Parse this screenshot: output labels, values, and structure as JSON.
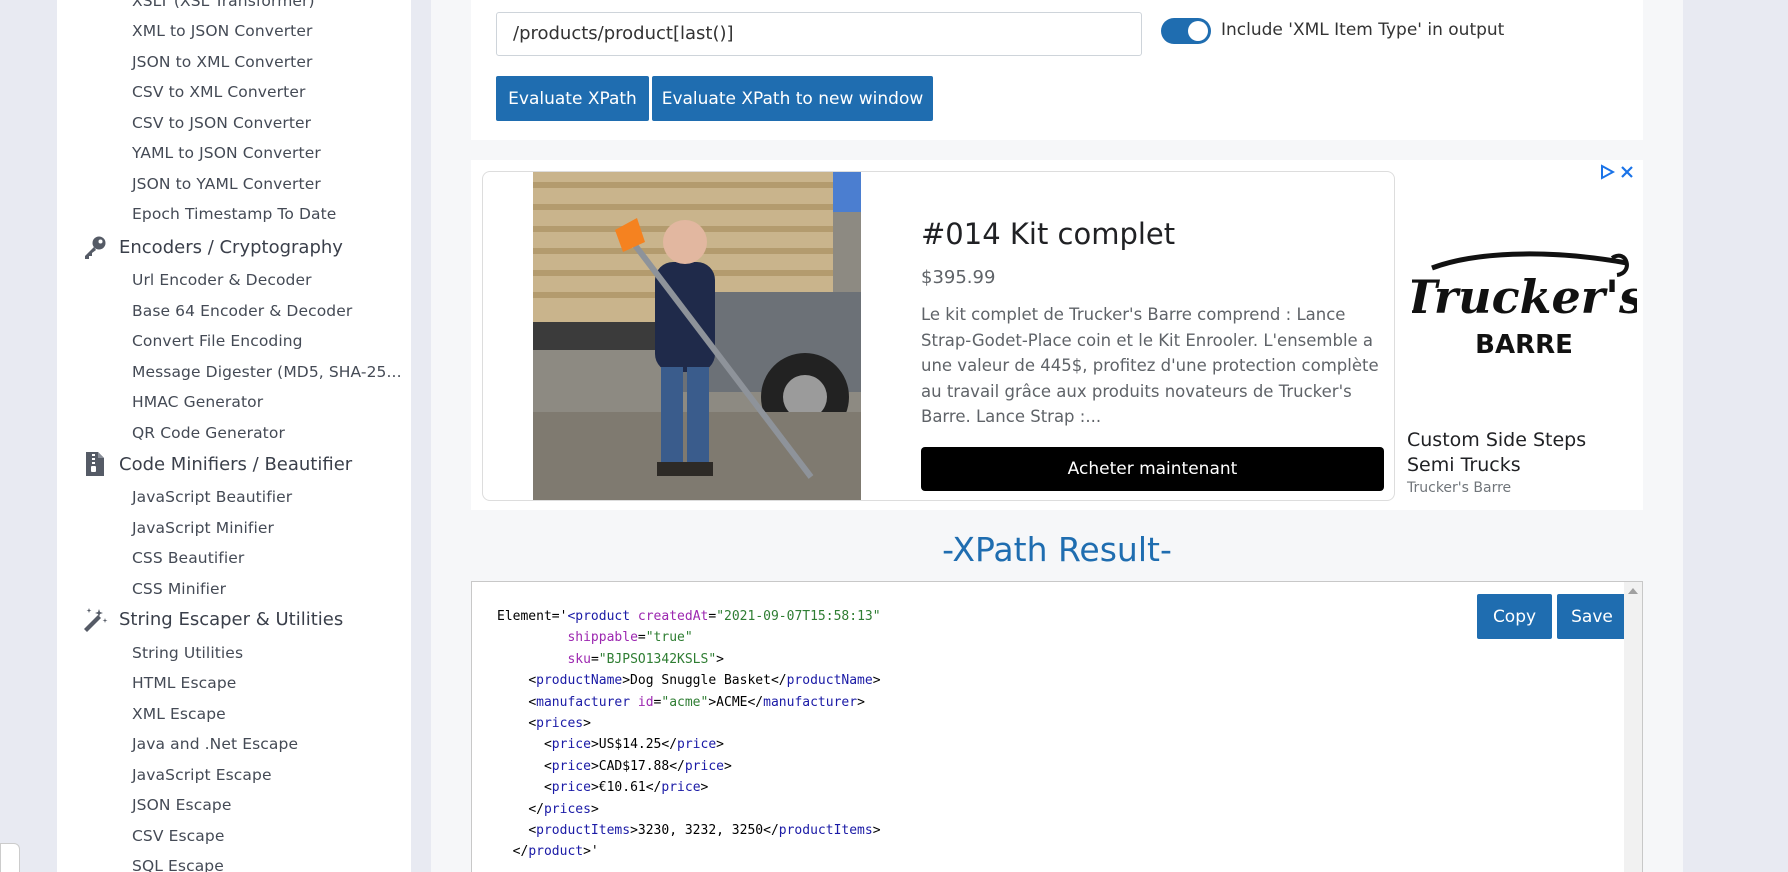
{
  "sidebar": {
    "partial_top_item": "XSLT (XSL Transformer)",
    "converters": [
      "XML to JSON Converter",
      "JSON to XML Converter",
      "CSV to XML Converter",
      "CSV to JSON Converter",
      "YAML to JSON Converter",
      "JSON to YAML Converter",
      "Epoch Timestamp To Date"
    ],
    "encoders_heading": "Encoders / Cryptography",
    "encoders": [
      "Url Encoder & Decoder",
      "Base 64 Encoder & Decoder",
      "Convert File Encoding",
      "Message Digester (MD5, SHA-25...",
      "HMAC Generator",
      "QR Code Generator"
    ],
    "minifiers_heading": "Code Minifiers / Beautifier",
    "minifiers": [
      "JavaScript Beautifier",
      "JavaScript Minifier",
      "CSS Beautifier",
      "CSS Minifier"
    ],
    "escaper_heading": "String Escaper & Utilities",
    "escapers": [
      "String Utilities",
      "HTML Escape",
      "XML Escape",
      "Java and .Net Escape",
      "JavaScript Escape",
      "JSON Escape",
      "CSV Escape",
      "SQL Escape"
    ]
  },
  "form": {
    "xpath_value": "/products/product[last()]",
    "toggle_on": true,
    "toggle_label": "Include 'XML Item Type' in output",
    "evaluate_label": "Evaluate XPath",
    "evaluate_new_window_label": "Evaluate XPath to new window"
  },
  "ad": {
    "title": "#014 Kit complet",
    "price": "$395.99",
    "description": "Le kit complet de Trucker's Barre comprend : Lance Strap-Godet-Place coin et le Kit Enrooler. L'ensemble a une valeur de 445$, profitez d'une protection complète au travail grâce aux produits novateurs de Trucker's Barre. Lance Strap :...",
    "cta_label": "Acheter maintenant",
    "logo_line1": "Trucker's",
    "logo_line2": "BARRE",
    "side_title": "Custom Side Steps Semi Trucks",
    "side_source": "Trucker's Barre"
  },
  "result": {
    "title": "-XPath Result-",
    "copy_label": "Copy",
    "save_label": "Save",
    "lines": [
      {
        "indent": 0,
        "parts": [
          [
            "t",
            "Element='"
          ],
          [
            "g",
            "<"
          ],
          [
            "n",
            "product"
          ],
          [
            "t",
            " "
          ],
          [
            "a",
            "createdAt"
          ],
          [
            "t",
            "="
          ],
          [
            "v",
            "\"2021-09-07T15:58:13\""
          ]
        ]
      },
      {
        "indent": 9,
        "parts": [
          [
            "a",
            "shippable"
          ],
          [
            "t",
            "="
          ],
          [
            "v",
            "\"true\""
          ]
        ]
      },
      {
        "indent": 9,
        "parts": [
          [
            "a",
            "sku"
          ],
          [
            "t",
            "="
          ],
          [
            "v",
            "\"BJPSO1342KSLS\""
          ],
          [
            "t",
            ">"
          ]
        ]
      },
      {
        "indent": 4,
        "parts": [
          [
            "t",
            "<"
          ],
          [
            "n",
            "productName"
          ],
          [
            "t",
            ">Dog Snuggle Basket</"
          ],
          [
            "n",
            "productName"
          ],
          [
            "t",
            ">"
          ]
        ]
      },
      {
        "indent": 4,
        "parts": [
          [
            "t",
            "<"
          ],
          [
            "n",
            "manufacturer"
          ],
          [
            "t",
            " "
          ],
          [
            "a",
            "id"
          ],
          [
            "t",
            "="
          ],
          [
            "v",
            "\"acme\""
          ],
          [
            "t",
            ">ACME</"
          ],
          [
            "n",
            "manufacturer"
          ],
          [
            "t",
            ">"
          ]
        ]
      },
      {
        "indent": 4,
        "parts": [
          [
            "t",
            "<"
          ],
          [
            "n",
            "prices"
          ],
          [
            "t",
            ">"
          ]
        ]
      },
      {
        "indent": 6,
        "parts": [
          [
            "t",
            "<"
          ],
          [
            "n",
            "price"
          ],
          [
            "t",
            ">US$14.25</"
          ],
          [
            "n",
            "price"
          ],
          [
            "t",
            ">"
          ]
        ]
      },
      {
        "indent": 6,
        "parts": [
          [
            "t",
            "<"
          ],
          [
            "n",
            "price"
          ],
          [
            "t",
            ">CAD$17.88</"
          ],
          [
            "n",
            "price"
          ],
          [
            "t",
            ">"
          ]
        ]
      },
      {
        "indent": 6,
        "parts": [
          [
            "t",
            "<"
          ],
          [
            "n",
            "price"
          ],
          [
            "t",
            ">€10.61</"
          ],
          [
            "n",
            "price"
          ],
          [
            "t",
            ">"
          ]
        ]
      },
      {
        "indent": 4,
        "parts": [
          [
            "t",
            "</"
          ],
          [
            "n",
            "prices"
          ],
          [
            "t",
            ">"
          ]
        ]
      },
      {
        "indent": 4,
        "parts": [
          [
            "t",
            "<"
          ],
          [
            "n",
            "productItems"
          ],
          [
            "t",
            ">3230, 3232, 3250</"
          ],
          [
            "n",
            "productItems"
          ],
          [
            "t",
            ">"
          ]
        ]
      },
      {
        "indent": 2,
        "parts": [
          [
            "t",
            "</"
          ],
          [
            "n",
            "product"
          ],
          [
            "t",
            ">'"
          ]
        ]
      }
    ]
  },
  "colors": {
    "accent": "#1f6db0",
    "tag": "#1a1aa6",
    "attr": "#9c27b0",
    "value": "#2e7d32"
  }
}
